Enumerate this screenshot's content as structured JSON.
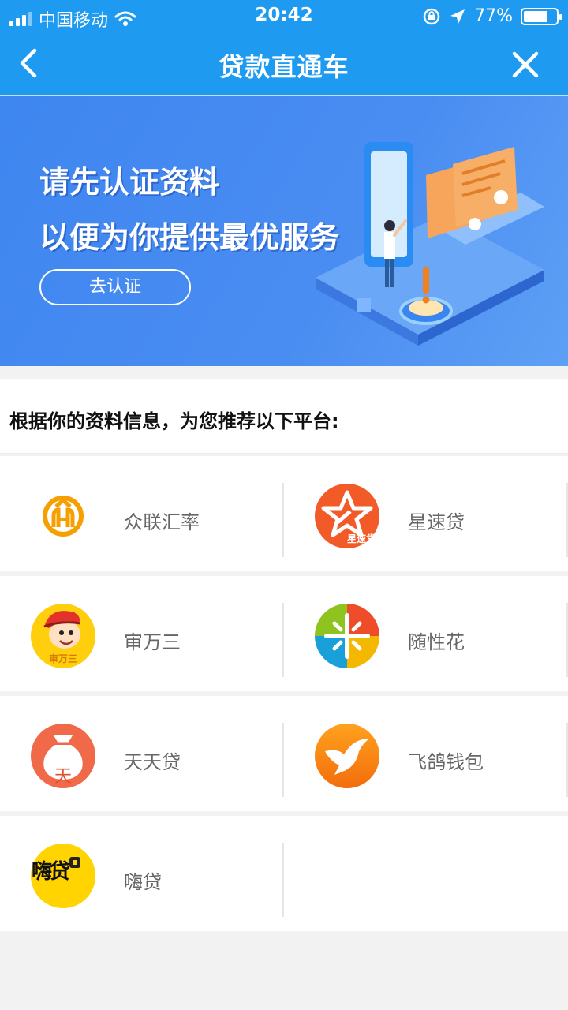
{
  "status_bar": {
    "carrier": "中国移动",
    "time": "20:42",
    "battery": "77%",
    "battery_level": 0.77
  },
  "nav": {
    "title": "贷款直通车"
  },
  "banner": {
    "line1": "请先认证资料",
    "line2": "以便为你提供最优服务",
    "button": "去认证"
  },
  "recommend": {
    "title": "根据你的资料信息，为您推荐以下平台:"
  },
  "platforms": [
    {
      "name": "众联汇率",
      "icon": "zhonglian-logo-icon"
    },
    {
      "name": "星速贷",
      "icon": "xingsudai-logo-icon",
      "logo_text": "星速贷"
    },
    {
      "name": "审万三",
      "icon": "shenwansan-logo-icon",
      "logo_text": "审万三"
    },
    {
      "name": "随性花",
      "icon": "suixinghua-logo-icon"
    },
    {
      "name": "天天贷",
      "icon": "tiantiandai-logo-icon",
      "logo_text": "天"
    },
    {
      "name": "飞鸽钱包",
      "icon": "feige-logo-icon"
    },
    {
      "name": "嗨贷",
      "icon": "haidai-logo-icon",
      "logo_text": "嗨贷"
    }
  ],
  "colors": {
    "primary": "#1e9bf0",
    "banner": "#4a8df2",
    "orange": "#f08020",
    "yellow": "#ffd400"
  }
}
